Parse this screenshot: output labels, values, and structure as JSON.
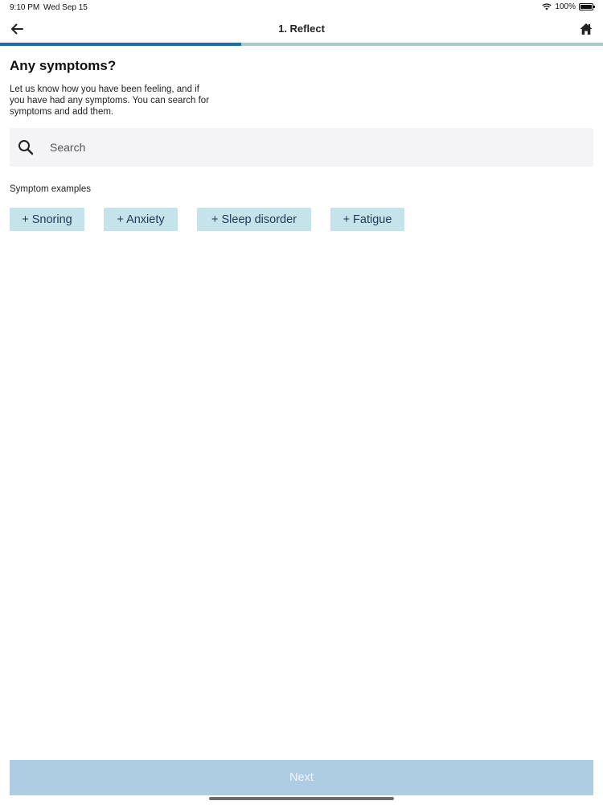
{
  "status_bar": {
    "time": "9:10 PM",
    "date": "Wed Sep 15",
    "battery": "100%",
    "wifi_icon": "wifi-icon",
    "battery_icon": "battery-full-icon"
  },
  "nav": {
    "title": "1. Reflect",
    "back_icon": "arrow-left-icon",
    "home_icon": "home-icon"
  },
  "progress": {
    "fraction": 0.4,
    "fill_color": "#1b6fa3",
    "track_color": "#a9c8d3"
  },
  "main": {
    "title": "Any symptoms?",
    "description": "Let us know how you have been feeling, and if you have had any symptoms. You can search for symptoms and add them.",
    "search": {
      "placeholder": "Search",
      "icon": "search-icon"
    },
    "examples_label": "Symptom examples",
    "chips": [
      {
        "label": "+ Snoring"
      },
      {
        "label": "+ Anxiety"
      },
      {
        "label": "+ Sleep disorder"
      },
      {
        "label": "+ Fatigue"
      }
    ]
  },
  "footer": {
    "next_label": "Next"
  },
  "colors": {
    "chip_bg": "#c5e3ea",
    "chip_text": "#1d3b58",
    "next_bg": "#aecde2"
  }
}
